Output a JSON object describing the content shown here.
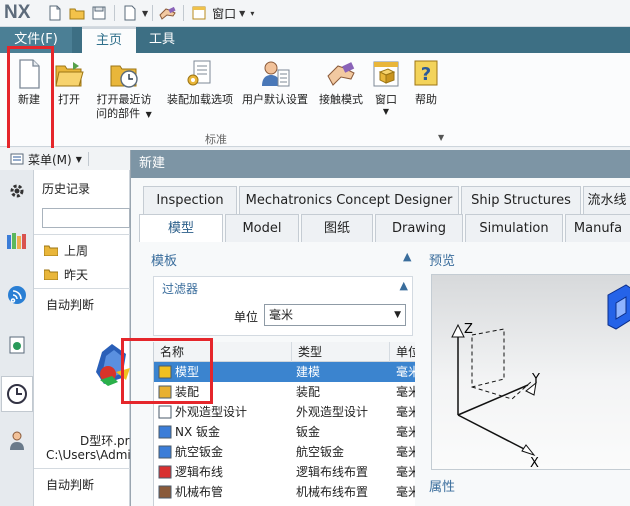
{
  "app": {
    "logo": "NX",
    "window_menu_label": "窗口"
  },
  "tabs": {
    "file": "文件(F)",
    "home": "主页",
    "tools": "工具"
  },
  "ribbon": {
    "new": "新建",
    "open": "打开",
    "recent_line1": "打开最近访",
    "recent_line2": "问的部件",
    "assembly_load": "装配加载选项",
    "user_defaults": "用户默认设置",
    "touch_mode": "接触模式",
    "window": "窗口",
    "help": "帮助",
    "group_label": "标准"
  },
  "menubar": {
    "label": "菜单(M)"
  },
  "history": {
    "title": "历史记录",
    "last_week": "上周",
    "yesterday": "昨天",
    "auto1": "自动判断",
    "file_name": "D型环.pr",
    "file_path": "C:\\Users\\Admi",
    "auto2": "自动判断"
  },
  "dialog": {
    "title": "新建",
    "tabs_row1": [
      "Inspection",
      "Mechatronics Concept Designer",
      "Ship Structures",
      "流水线"
    ],
    "tabs_row2": [
      "模型",
      "Model",
      "图纸",
      "Drawing",
      "Simulation",
      "Manufa"
    ],
    "template_label": "模板",
    "preview_label": "预览",
    "properties_label": "属性",
    "filter": {
      "label": "过滤器",
      "unit_label": "单位",
      "unit_value": "毫米"
    },
    "table": {
      "headers": [
        "名称",
        "类型",
        "单位"
      ],
      "rows": [
        {
          "name": "模型",
          "type": "建模",
          "unit": "毫米",
          "selected": true,
          "icon": "model-icon"
        },
        {
          "name": "装配",
          "type": "装配",
          "unit": "毫米",
          "selected": false,
          "icon": "assembly-icon"
        },
        {
          "name": "外观造型设计",
          "type": "外观造型设计",
          "unit": "毫米",
          "selected": false,
          "icon": "shape-studio-icon"
        },
        {
          "name": "NX 钣金",
          "type": "钣金",
          "unit": "毫米",
          "selected": false,
          "icon": "sheet-metal-icon"
        },
        {
          "name": "航空钣金",
          "type": "航空钣金",
          "unit": "毫米",
          "selected": false,
          "icon": "aero-sheet-metal-icon"
        },
        {
          "name": "逻辑布线",
          "type": "逻辑布线布置",
          "unit": "毫米",
          "selected": false,
          "icon": "logical-routing-icon"
        },
        {
          "name": "机械布管",
          "type": "机械布线布置",
          "unit": "毫米",
          "selected": false,
          "icon": "mechanical-routing-icon"
        }
      ]
    },
    "preview_axes": {
      "z": "Z",
      "y": "Y",
      "x": "X"
    }
  },
  "colors": {
    "accent": "#3d6f84",
    "selection": "#3b84cf",
    "highlight_box": "#e5262b"
  }
}
